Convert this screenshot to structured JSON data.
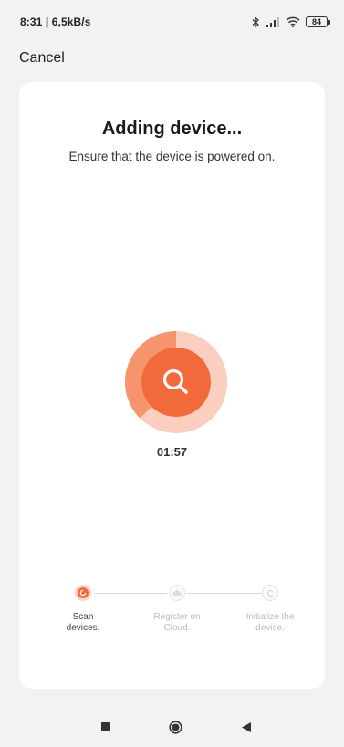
{
  "status_bar": {
    "time_speed": "8:31 | 6,5kB/s",
    "battery_level": "84",
    "icons": [
      "bluetooth-icon",
      "signal-icon",
      "wifi-icon",
      "battery-icon"
    ]
  },
  "header": {
    "cancel_label": "Cancel"
  },
  "card": {
    "title": "Adding device...",
    "subtitle": "Ensure that the device is powered on.",
    "timer": "01:57",
    "accent_color": "#f26a3c",
    "steps": [
      {
        "label": "Scan\ndevices.",
        "state": "active",
        "icon": "scan-icon"
      },
      {
        "label": "Register on\nCloud.",
        "state": "pending",
        "icon": "cloud-icon"
      },
      {
        "label": "Initialize the\ndevice.",
        "state": "pending",
        "icon": "initialize-icon"
      }
    ]
  },
  "nav_bar": {
    "icons": [
      "recent-apps-icon",
      "home-icon",
      "back-icon"
    ]
  }
}
